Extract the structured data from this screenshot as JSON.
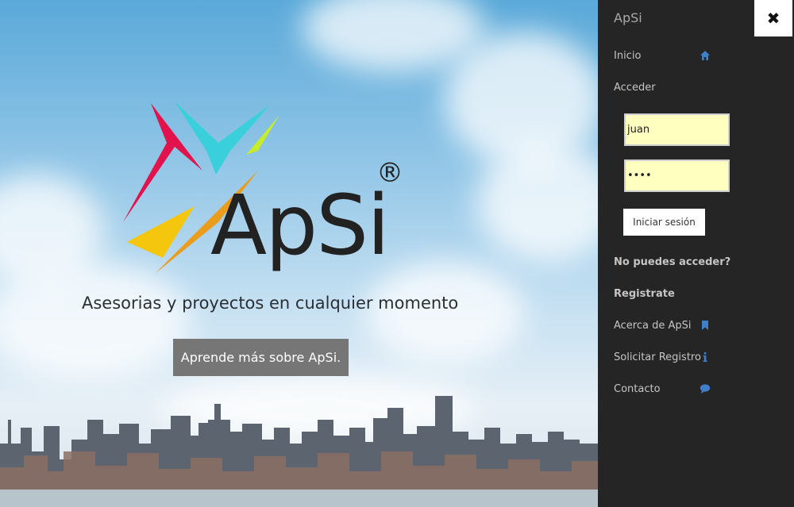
{
  "hero": {
    "logo_text": "ApSi",
    "registered_mark": "®",
    "tagline": "Asesorias y proyectos en cualquier momento",
    "cta_label": "Aprende más sobre ApSi."
  },
  "sidebar": {
    "brand": "ApSi",
    "close_glyph": "✖",
    "items": {
      "inicio": {
        "label": "Inicio",
        "icon": "home-icon"
      },
      "acceder": {
        "label": "Acceder"
      },
      "no_puedes": {
        "label": "No puedes acceder?"
      },
      "registrate": {
        "label": "Registrate"
      },
      "acerca": {
        "label": "Acerca de ApSi",
        "icon": "bookmark-icon"
      },
      "solicitar": {
        "label": "Solicitar Registro",
        "icon": "info-icon"
      },
      "contacto": {
        "label": "Contacto",
        "icon": "comment-icon"
      }
    }
  },
  "login": {
    "username_value": "juan",
    "password_value": "xxxx",
    "submit_label": "Iniciar sesión"
  },
  "colors": {
    "sidebar_bg": "#252525",
    "icon_blue": "#3f7fc9",
    "input_bg": "#ffffc0",
    "cta_bg": "#767676"
  }
}
